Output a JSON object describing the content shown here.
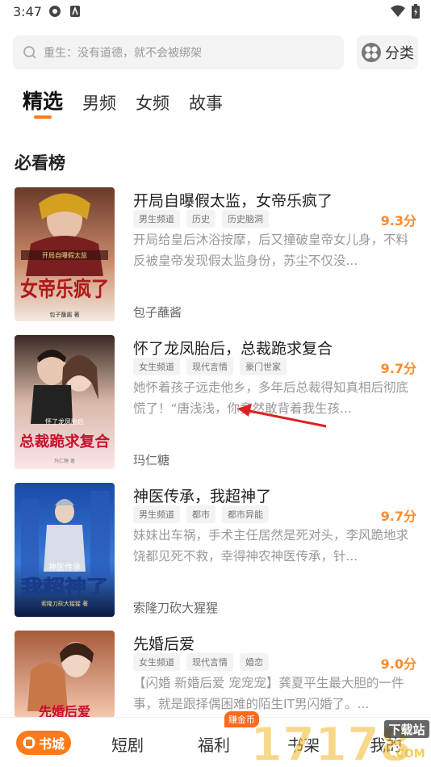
{
  "status": {
    "time": "3:47"
  },
  "search": {
    "placeholder": "重生：没有道德，就不会被绑架",
    "category_label": "分类"
  },
  "tabs": [
    {
      "label": "精选",
      "active": true
    },
    {
      "label": "男频",
      "active": false
    },
    {
      "label": "女频",
      "active": false
    },
    {
      "label": "故事",
      "active": false
    }
  ],
  "section": {
    "title": "必看榜"
  },
  "books": [
    {
      "title": "开局自曝假太监，女帝乐疯了",
      "tags": [
        "男生频道",
        "历史",
        "历史脑洞"
      ],
      "score": "9.3分",
      "desc": "开局给皇后沐浴按摩，后又撞破皇帝女儿身，不料反被皇帝发现假太监身份，苏尘不仅没...",
      "author": "包子蘸酱"
    },
    {
      "title": "怀了龙凤胎后，总裁跪求复合",
      "tags": [
        "女生频道",
        "现代言情",
        "豪门世家"
      ],
      "score": "9.7分",
      "desc": "她怀着孩子远走他乡，多年后总裁得知真相后彻底慌了！“唐浅浅，你竟然敢背着我生孩...",
      "author": "玛仁糖"
    },
    {
      "title": "神医传承，我超神了",
      "tags": [
        "男生频道",
        "都市",
        "都市异能"
      ],
      "score": "9.7分",
      "desc": "妹妹出车祸，手术主任居然是死对头，李风跪地求饶都见死不救，幸得神农神医传承，针...",
      "author": "索隆刀砍大猩猩"
    },
    {
      "title": "先婚后爱",
      "tags": [
        "女生频道",
        "现代言情",
        "婚恋"
      ],
      "score": "9.0分",
      "desc": "【闪婚 新婚后爱 宠宠宠】龚夏平生最大胆的一件事，就是跟择偶困难的陌生IT男闪婚了。...",
      "author": ""
    }
  ],
  "covers": [
    {
      "text_top": "开局自曝假太监",
      "text_main": "女帝乐疯了",
      "author": "包子蘸酱 著"
    },
    {
      "text_top": "怀了龙凤胎后",
      "text_main": "总裁跪求复合",
      "author": "玛仁糖 著"
    },
    {
      "text_top": "神医传承",
      "text_main": "我超神了",
      "author": "索隆刀砍大猩猩 著"
    },
    {
      "text_main": "先婚后爱"
    }
  ],
  "bottom_nav": {
    "home": "书城",
    "shorts": "短剧",
    "welfare": "福利",
    "shelf": "书架",
    "mine": "我的",
    "badge": "赚金币"
  },
  "watermark": {
    "number": "17178",
    "tag": "下载站",
    "domain": ".COM"
  },
  "colors": {
    "accent": "#ff7a1a",
    "score": "#ff8a2a",
    "arrow": "#e02020"
  }
}
